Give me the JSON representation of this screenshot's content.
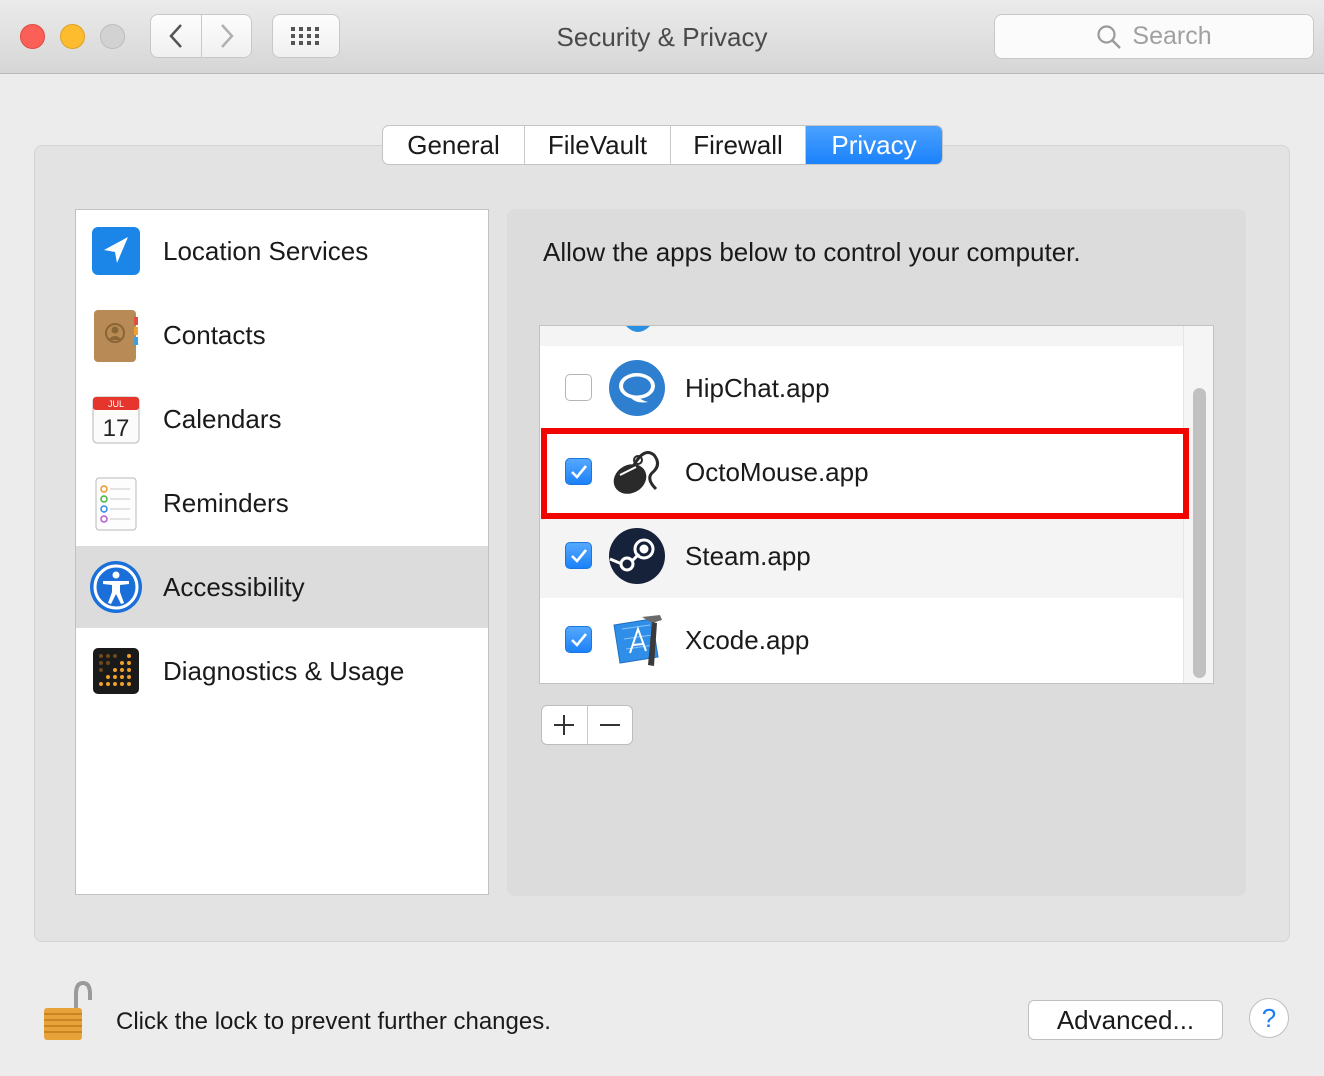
{
  "window": {
    "title": "Security & Privacy"
  },
  "toolbar": {
    "search_placeholder": "Search"
  },
  "tabs": [
    {
      "label": "General",
      "active": false
    },
    {
      "label": "FileVault",
      "active": false
    },
    {
      "label": "Firewall",
      "active": false
    },
    {
      "label": "Privacy",
      "active": true
    }
  ],
  "sidebar": {
    "items": [
      {
        "label": "Location Services",
        "icon": "location-arrow-icon"
      },
      {
        "label": "Contacts",
        "icon": "contacts-book-icon"
      },
      {
        "label": "Calendars",
        "icon": "calendar-icon",
        "icon_month": "JUL",
        "icon_day": "17"
      },
      {
        "label": "Reminders",
        "icon": "reminders-list-icon"
      },
      {
        "label": "Accessibility",
        "icon": "accessibility-icon",
        "selected": true
      },
      {
        "label": "Diagnostics & Usage",
        "icon": "diagnostics-grid-icon"
      }
    ]
  },
  "panel": {
    "description": "Allow the apps below to control your computer.",
    "apps": [
      {
        "name": "HipChat.app",
        "checked": false,
        "icon": "hipchat-icon"
      },
      {
        "name": "OctoMouse.app",
        "checked": true,
        "icon": "octomouse-icon",
        "highlighted": true
      },
      {
        "name": "Steam.app",
        "checked": true,
        "icon": "steam-icon"
      },
      {
        "name": "Xcode.app",
        "checked": true,
        "icon": "xcode-icon"
      }
    ],
    "add_label": "+",
    "remove_label": "−"
  },
  "footer": {
    "lock_text": "Click the lock to prevent further changes.",
    "advanced_label": "Advanced...",
    "help_label": "?"
  },
  "colors": {
    "accent": "#1a82fb",
    "highlight_border": "#f00500",
    "selected_row": "#dcdcdc"
  }
}
